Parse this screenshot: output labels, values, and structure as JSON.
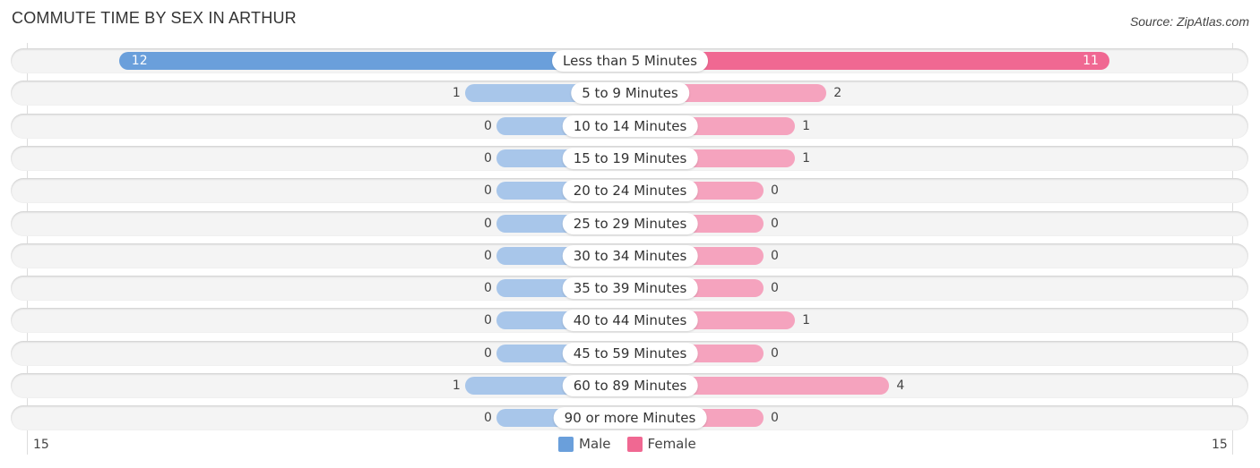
{
  "header": {
    "title": "COMMUTE TIME BY SEX IN ARTHUR",
    "source": "Source: ZipAtlas.com"
  },
  "colors": {
    "male": "#6a9fdb",
    "male_light": "#a8c6ea",
    "female": "#f06892",
    "female_light": "#f5a3be"
  },
  "chart_data": {
    "type": "bar",
    "orientation": "horizontal-diverging",
    "title": "COMMUTE TIME BY SEX IN ARTHUR",
    "categories": [
      "Less than 5 Minutes",
      "5 to 9 Minutes",
      "10 to 14 Minutes",
      "15 to 19 Minutes",
      "20 to 24 Minutes",
      "25 to 29 Minutes",
      "30 to 34 Minutes",
      "35 to 39 Minutes",
      "40 to 44 Minutes",
      "45 to 59 Minutes",
      "60 to 89 Minutes",
      "90 or more Minutes"
    ],
    "series": [
      {
        "name": "Male",
        "values": [
          12,
          1,
          0,
          0,
          0,
          0,
          0,
          0,
          0,
          0,
          1,
          0
        ]
      },
      {
        "name": "Female",
        "values": [
          11,
          2,
          1,
          1,
          0,
          0,
          0,
          0,
          1,
          0,
          4,
          0
        ]
      }
    ],
    "axis": {
      "left_label": "15",
      "right_label": "15",
      "range": [
        0,
        15
      ]
    },
    "legend": {
      "position": "bottom-center",
      "items": [
        "Male",
        "Female"
      ]
    }
  }
}
